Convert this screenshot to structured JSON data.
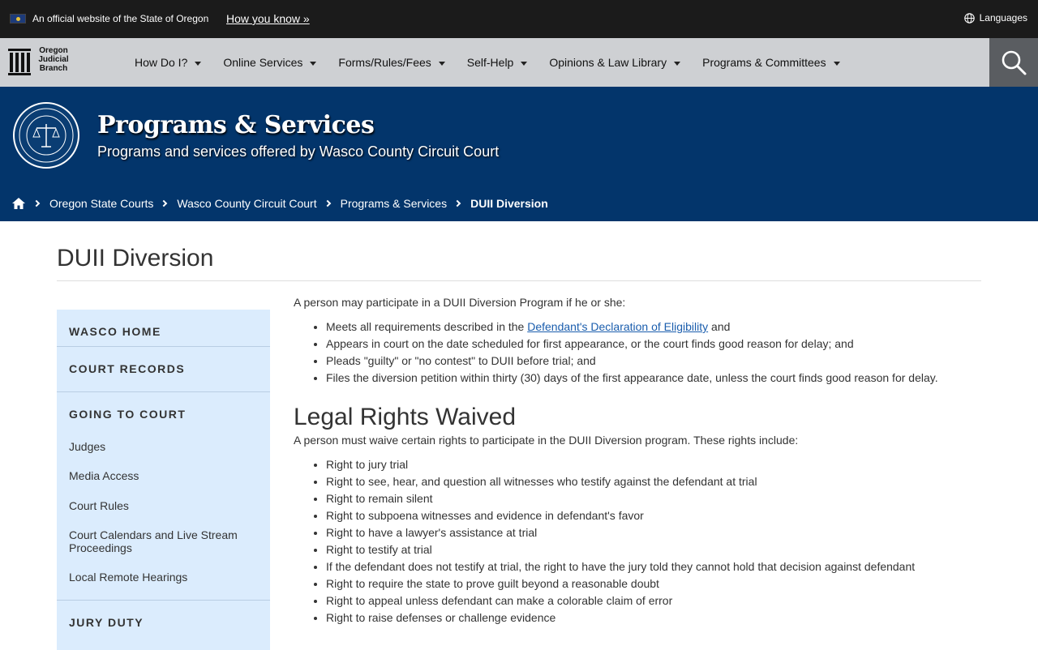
{
  "gov_bar": {
    "official_text": "An official website of the State of Oregon",
    "how_you_know": "How you know »",
    "languages": "Languages"
  },
  "nav": {
    "logo_lines": [
      "Oregon",
      "Judicial",
      "Branch"
    ],
    "items": [
      {
        "label": "How Do I?"
      },
      {
        "label": "Online Services"
      },
      {
        "label": "Forms/Rules/Fees"
      },
      {
        "label": "Self-Help"
      },
      {
        "label": "Opinions & Law Library"
      },
      {
        "label": "Programs & Committees"
      }
    ]
  },
  "banner": {
    "title": "Programs & Services",
    "subtitle": "Programs and services offered by Wasco County Circuit Court",
    "seal_text": "JUDICIAL DEPARTMENT · STATE OF OREGON"
  },
  "breadcrumb": {
    "items": [
      "Oregon State Courts",
      "Wasco County Circuit Court",
      "Programs & Services"
    ],
    "current": "DUII Diversion"
  },
  "page": {
    "title": "DUII Diversion"
  },
  "sidebar": {
    "wasco_home": "WASCO HOME",
    "court_records": "COURT RECORDS",
    "going_to_court": "GOING TO COURT",
    "links": [
      "Judges",
      "Media Access",
      "Court Rules",
      "Court Calendars and Live Stream Proceedings",
      "Local Remote Hearings"
    ],
    "jury_duty": "JURY DUTY"
  },
  "content": {
    "intro": "A person may participate in a DUII Diversion Program if he or she:",
    "eligibility_link_pre": "Meets all requirements described in the ",
    "eligibility_link": "Defendant's Declaration of Eligibility",
    "eligibility_link_post": " and",
    "requirements": [
      "Appears in court on the date scheduled for first appearance, or the court finds good reason for delay; and",
      "Pleads \"guilty\" or \"no contest\" to DUII before trial; and",
      "Files the diversion petition within thirty (30) days of the first appearance date, unless the court finds good reason for delay."
    ],
    "rights_heading": "Legal Rights Waived",
    "rights_intro": "A person must waive certain rights to participate in the DUII Diversion program. These rights include:",
    "rights": [
      "Right to jury trial",
      "Right to see, hear, and question all witnesses who testify against the defendant at trial",
      "Right to remain silent",
      "Right to subpoena witnesses and evidence in defendant's favor",
      "Right to have a lawyer's assistance at trial",
      "Right to testify at trial",
      "If the defendant does not testify at trial, the right to have the jury told they cannot hold that decision against defendant",
      "Right to require the state to prove guilt beyond a reasonable doubt",
      "Right to appeal unless defendant can make a colorable claim of error",
      "Right to raise defenses or challenge evidence"
    ]
  },
  "colors": {
    "banner": "#03356b",
    "nav_bg": "#ced0d3",
    "sidebar_bg": "#dbecfd",
    "link": "#1a5dad"
  }
}
